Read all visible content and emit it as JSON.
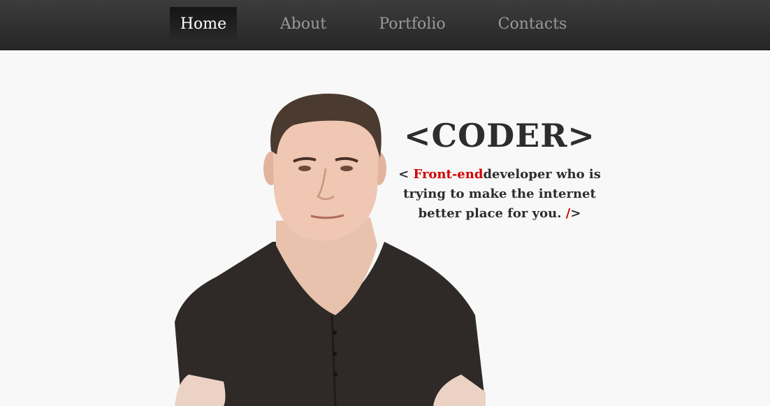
{
  "nav": {
    "items": [
      {
        "label": "Home",
        "active": true
      },
      {
        "label": "About",
        "active": false
      },
      {
        "label": "Portfolio",
        "active": false
      },
      {
        "label": "Contacts",
        "active": false
      }
    ]
  },
  "hero": {
    "title": "<CODER>",
    "tagline": {
      "open": "< ",
      "highlight": "Front-end",
      "line1_rest": "developer who is",
      "line2": "trying to make the internet",
      "line3": "better place for you. ",
      "close_slash": "/",
      "close_bracket": ">"
    }
  },
  "colors": {
    "navbar": "#2e2e2e",
    "background": "#f8f8f8",
    "accent": "#d30000",
    "text": "#2d2d2d"
  }
}
